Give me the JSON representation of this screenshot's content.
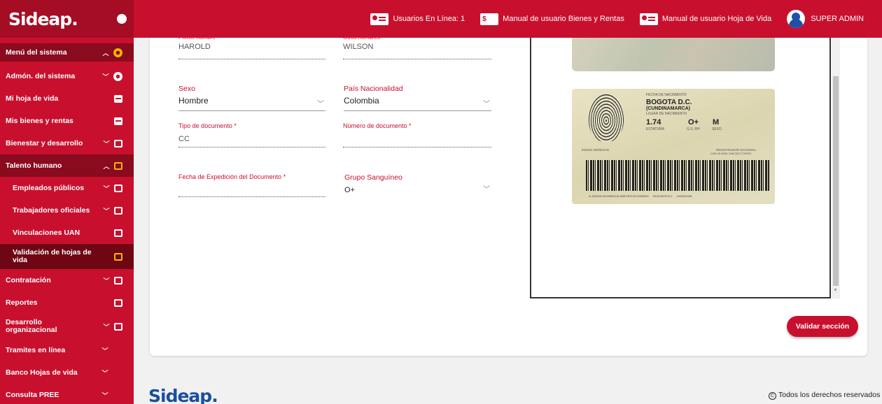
{
  "header": {
    "logo_text": "Sideap.",
    "online_users": "Usuarios En Línea: 1",
    "manual_bienes": "Manual de usuario Bienes y Rentas",
    "manual_hoja": "Manual de usuario Hoja de Vida",
    "user_name": "SUPER ADMIN",
    "money_icon_text": "$"
  },
  "sidebar": {
    "items": [
      {
        "label": "Menú del sistema"
      },
      {
        "label": "Admón. del sistema"
      },
      {
        "label": "Mi hoja de vida"
      },
      {
        "label": "Mis bienes y rentas"
      },
      {
        "label": "Bienestar y desarrollo"
      },
      {
        "label": "Talento humano"
      },
      {
        "label": "Empleados públicos"
      },
      {
        "label": "Trabajadores oficiales"
      },
      {
        "label": "Vinculaciones UAN"
      },
      {
        "label": "Validación de hojas de vida"
      },
      {
        "label": "Contratación"
      },
      {
        "label": "Reportes"
      },
      {
        "label": "Desarrollo organizacional"
      },
      {
        "label": "Tramites en línea"
      },
      {
        "label": "Banco Hojas de vida"
      },
      {
        "label": "Consulta PREE"
      }
    ]
  },
  "form": {
    "primer_nombre_label": "Primer nombre",
    "primer_nombre_value": "HAROLD",
    "otros_nombres_label": "Otros nombres",
    "otros_nombres_value": "WILSON",
    "sexo_label": "Sexo",
    "sexo_value": "Hombre",
    "pais_label": "País Nacionalidad",
    "pais_value": "Colombia",
    "tipo_doc_label": "Tipo de documento *",
    "tipo_doc_value": "CC",
    "numero_doc_label": "Número de documento *",
    "numero_doc_value": "",
    "fecha_exp_label": "Fecha de Expedición del Documento *",
    "fecha_exp_value": "",
    "grupo_label": "Grupo Sanguíneo",
    "grupo_value": "O+"
  },
  "id_card": {
    "fecha_nac_label": "FECHA DE NACIMIENTO",
    "city": "BOGOTA D.C.",
    "region": "(CUNDINAMARCA)",
    "lugar_label": "LUGAR DE NACIMIENTO",
    "estatura": "1.74",
    "estatura_label": "ESTATURA",
    "rh": "O+",
    "rh_label": "G.S. RH",
    "sexo": "M",
    "sexo_label": "SEXO",
    "indice_label": "INDICE DERECHO",
    "registrador_label": "REGISTRADOR NACIONAL",
    "registrador_name": "CARLOS ARIEL SÁNCHEZ TORRES",
    "code_line": "A-1500150-00158263-M-0080787678-20090801     0012036787A 1     1160031508"
  },
  "actions": {
    "validar_label": "Validar sección"
  },
  "footer": {
    "logo_text": "Sideap.",
    "rights": "Todos los derechos reservados",
    "copyright_symbol": "C"
  }
}
